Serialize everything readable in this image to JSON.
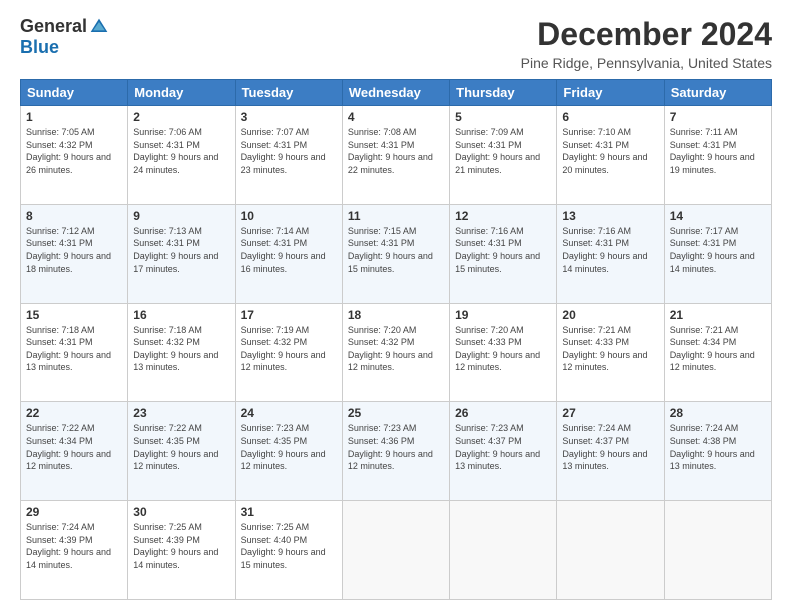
{
  "logo": {
    "general": "General",
    "blue": "Blue"
  },
  "title": "December 2024",
  "location": "Pine Ridge, Pennsylvania, United States",
  "days_header": [
    "Sunday",
    "Monday",
    "Tuesday",
    "Wednesday",
    "Thursday",
    "Friday",
    "Saturday"
  ],
  "weeks": [
    [
      {
        "day": "1",
        "sunrise": "7:05 AM",
        "sunset": "4:32 PM",
        "daylight": "9 hours and 26 minutes."
      },
      {
        "day": "2",
        "sunrise": "7:06 AM",
        "sunset": "4:31 PM",
        "daylight": "9 hours and 24 minutes."
      },
      {
        "day": "3",
        "sunrise": "7:07 AM",
        "sunset": "4:31 PM",
        "daylight": "9 hours and 23 minutes."
      },
      {
        "day": "4",
        "sunrise": "7:08 AM",
        "sunset": "4:31 PM",
        "daylight": "9 hours and 22 minutes."
      },
      {
        "day": "5",
        "sunrise": "7:09 AM",
        "sunset": "4:31 PM",
        "daylight": "9 hours and 21 minutes."
      },
      {
        "day": "6",
        "sunrise": "7:10 AM",
        "sunset": "4:31 PM",
        "daylight": "9 hours and 20 minutes."
      },
      {
        "day": "7",
        "sunrise": "7:11 AM",
        "sunset": "4:31 PM",
        "daylight": "9 hours and 19 minutes."
      }
    ],
    [
      {
        "day": "8",
        "sunrise": "7:12 AM",
        "sunset": "4:31 PM",
        "daylight": "9 hours and 18 minutes."
      },
      {
        "day": "9",
        "sunrise": "7:13 AM",
        "sunset": "4:31 PM",
        "daylight": "9 hours and 17 minutes."
      },
      {
        "day": "10",
        "sunrise": "7:14 AM",
        "sunset": "4:31 PM",
        "daylight": "9 hours and 16 minutes."
      },
      {
        "day": "11",
        "sunrise": "7:15 AM",
        "sunset": "4:31 PM",
        "daylight": "9 hours and 15 minutes."
      },
      {
        "day": "12",
        "sunrise": "7:16 AM",
        "sunset": "4:31 PM",
        "daylight": "9 hours and 15 minutes."
      },
      {
        "day": "13",
        "sunrise": "7:16 AM",
        "sunset": "4:31 PM",
        "daylight": "9 hours and 14 minutes."
      },
      {
        "day": "14",
        "sunrise": "7:17 AM",
        "sunset": "4:31 PM",
        "daylight": "9 hours and 14 minutes."
      }
    ],
    [
      {
        "day": "15",
        "sunrise": "7:18 AM",
        "sunset": "4:31 PM",
        "daylight": "9 hours and 13 minutes."
      },
      {
        "day": "16",
        "sunrise": "7:18 AM",
        "sunset": "4:32 PM",
        "daylight": "9 hours and 13 minutes."
      },
      {
        "day": "17",
        "sunrise": "7:19 AM",
        "sunset": "4:32 PM",
        "daylight": "9 hours and 12 minutes."
      },
      {
        "day": "18",
        "sunrise": "7:20 AM",
        "sunset": "4:32 PM",
        "daylight": "9 hours and 12 minutes."
      },
      {
        "day": "19",
        "sunrise": "7:20 AM",
        "sunset": "4:33 PM",
        "daylight": "9 hours and 12 minutes."
      },
      {
        "day": "20",
        "sunrise": "7:21 AM",
        "sunset": "4:33 PM",
        "daylight": "9 hours and 12 minutes."
      },
      {
        "day": "21",
        "sunrise": "7:21 AM",
        "sunset": "4:34 PM",
        "daylight": "9 hours and 12 minutes."
      }
    ],
    [
      {
        "day": "22",
        "sunrise": "7:22 AM",
        "sunset": "4:34 PM",
        "daylight": "9 hours and 12 minutes."
      },
      {
        "day": "23",
        "sunrise": "7:22 AM",
        "sunset": "4:35 PM",
        "daylight": "9 hours and 12 minutes."
      },
      {
        "day": "24",
        "sunrise": "7:23 AM",
        "sunset": "4:35 PM",
        "daylight": "9 hours and 12 minutes."
      },
      {
        "day": "25",
        "sunrise": "7:23 AM",
        "sunset": "4:36 PM",
        "daylight": "9 hours and 12 minutes."
      },
      {
        "day": "26",
        "sunrise": "7:23 AM",
        "sunset": "4:37 PM",
        "daylight": "9 hours and 13 minutes."
      },
      {
        "day": "27",
        "sunrise": "7:24 AM",
        "sunset": "4:37 PM",
        "daylight": "9 hours and 13 minutes."
      },
      {
        "day": "28",
        "sunrise": "7:24 AM",
        "sunset": "4:38 PM",
        "daylight": "9 hours and 13 minutes."
      }
    ],
    [
      {
        "day": "29",
        "sunrise": "7:24 AM",
        "sunset": "4:39 PM",
        "daylight": "9 hours and 14 minutes."
      },
      {
        "day": "30",
        "sunrise": "7:25 AM",
        "sunset": "4:39 PM",
        "daylight": "9 hours and 14 minutes."
      },
      {
        "day": "31",
        "sunrise": "7:25 AM",
        "sunset": "4:40 PM",
        "daylight": "9 hours and 15 minutes."
      },
      null,
      null,
      null,
      null
    ]
  ],
  "labels": {
    "sunrise": "Sunrise:",
    "sunset": "Sunset:",
    "daylight": "Daylight:"
  }
}
